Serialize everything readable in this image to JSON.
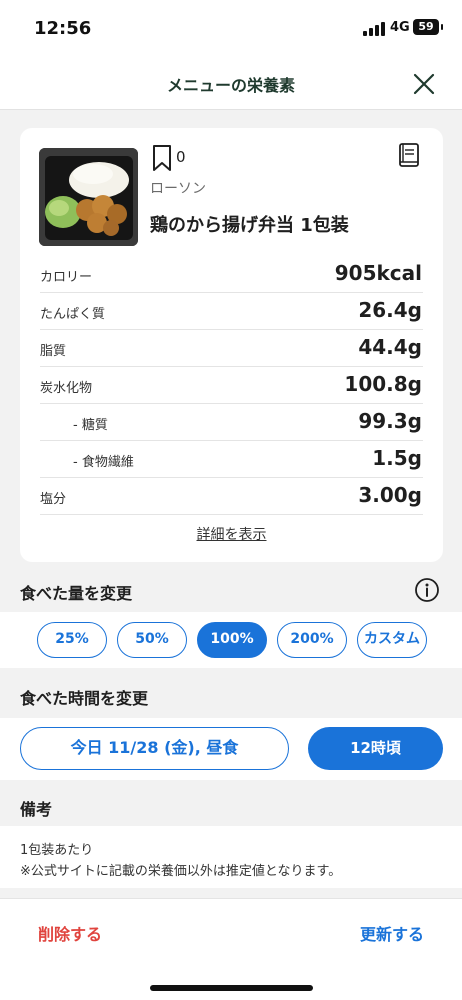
{
  "status_bar": {
    "time": "12:56",
    "network": "4G",
    "battery": "59"
  },
  "nav": {
    "title": "メニューの栄養素"
  },
  "food": {
    "bookmark_count": "0",
    "brand": "ローソン",
    "name": "鶏のから揚げ弁当 1包装"
  },
  "nutrition": [
    {
      "label": "カロリー",
      "value": "905kcal"
    },
    {
      "label": "たんぱく質",
      "value": "26.4g"
    },
    {
      "label": "脂質",
      "value": "44.4g"
    },
    {
      "label": "炭水化物",
      "value": "100.8g"
    },
    {
      "label": "- 糖質",
      "value": "99.3g"
    },
    {
      "label": "- 食物繊維",
      "value": "1.5g"
    },
    {
      "label": "塩分",
      "value": "3.00g"
    }
  ],
  "details_link": "詳細を表示",
  "quantity": {
    "title": "食べた量を変更",
    "options": [
      "25%",
      "50%",
      "100%",
      "200%",
      "カスタム"
    ],
    "selected": "100%"
  },
  "time_section": {
    "title": "食べた時間を変更",
    "date": "今日 11/28 (金), 昼食",
    "hour": "12時頃"
  },
  "memo": {
    "title": "備考",
    "line1": "1包装あたり",
    "line2": "※公式サイトに記載の栄養価以外は推定値となります。"
  },
  "actions": {
    "delete": "削除する",
    "update": "更新する"
  },
  "colors": {
    "accent": "#1a73d9",
    "danger": "#e0443e",
    "title": "#1f3a2e"
  }
}
